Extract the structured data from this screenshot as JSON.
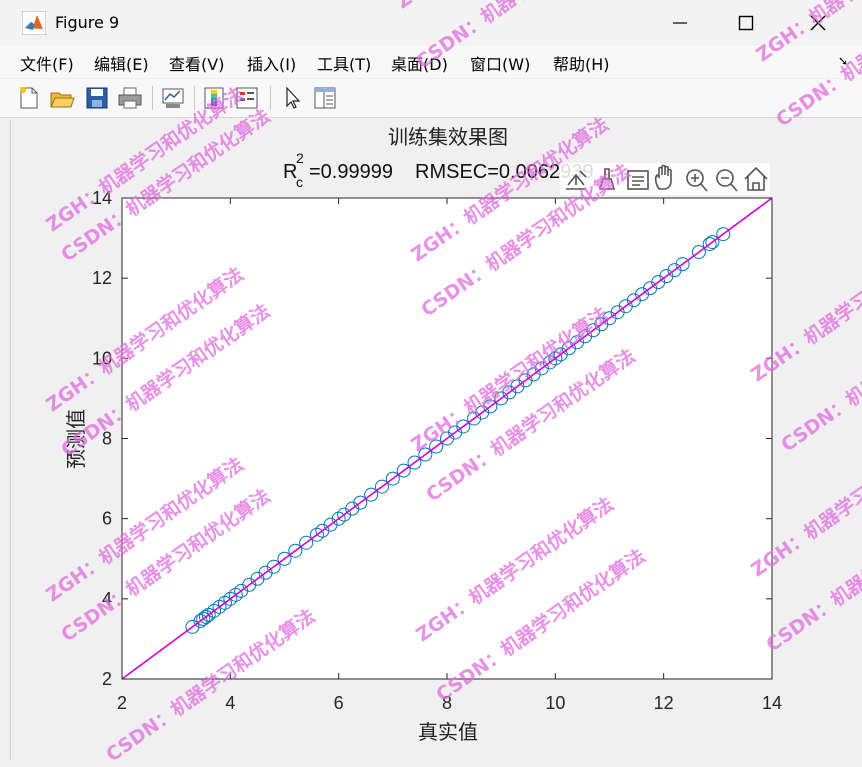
{
  "window": {
    "title": "Figure 9"
  },
  "menu": [
    "文件(F)",
    "编辑(E)",
    "查看(V)",
    "插入(I)",
    "工具(T)",
    "桌面(D)",
    "窗口(W)",
    "帮助(H)"
  ],
  "toolbar": {
    "buttons": [
      "new-figure-icon",
      "open-file-icon",
      "save-icon",
      "print-icon",
      "link-plot-icon",
      "insert-colorbar-icon",
      "insert-legend-icon",
      "edit-plot-arrow-icon",
      "property-inspector-icon"
    ]
  },
  "axes_toolbar": [
    "export-icon",
    "brush-icon",
    "data-tips-icon",
    "pan-icon",
    "zoom-in-icon",
    "zoom-out-icon",
    "home-icon"
  ],
  "watermarks": [
    "ZGH：机器学习和优化算法",
    "CSDN：机器学习和优化算法"
  ],
  "colors": {
    "marker": "#0072bd",
    "fit_line": "#d400d4",
    "watermark": "#e26be0"
  },
  "chart_data": {
    "type": "scatter",
    "title": "训练集效果图",
    "subtitle": {
      "r_label": "R",
      "r_sub": "c",
      "r_sup": "2",
      "r_value": "=0.99999",
      "rmse": "RMSEC=0.0062939"
    },
    "xlabel": "真实值",
    "ylabel": "预测值",
    "xlim": [
      2,
      14
    ],
    "ylim": [
      2,
      14
    ],
    "xticks": [
      2,
      4,
      6,
      8,
      10,
      12,
      14
    ],
    "yticks": [
      2,
      4,
      6,
      8,
      10,
      12,
      14
    ],
    "grid": false,
    "fit_line": {
      "x": [
        2,
        14
      ],
      "y": [
        2,
        14
      ]
    },
    "points": {
      "x": [
        3.3,
        3.45,
        3.5,
        3.55,
        3.6,
        3.7,
        3.8,
        3.9,
        4.0,
        4.1,
        4.2,
        4.35,
        4.5,
        4.65,
        4.8,
        5.0,
        5.2,
        5.4,
        5.6,
        5.7,
        5.85,
        6.0,
        6.1,
        6.25,
        6.4,
        6.6,
        6.8,
        7.0,
        7.2,
        7.4,
        7.6,
        7.8,
        8.0,
        8.15,
        8.3,
        8.5,
        8.65,
        8.8,
        9.0,
        9.15,
        9.3,
        9.45,
        9.6,
        9.75,
        9.9,
        10.0,
        10.1,
        10.25,
        10.4,
        10.55,
        10.7,
        10.85,
        11.0,
        11.15,
        11.3,
        11.45,
        11.6,
        11.75,
        11.9,
        12.05,
        12.2,
        12.35,
        12.65,
        12.85,
        12.9,
        13.1
      ],
      "y": [
        3.3,
        3.45,
        3.5,
        3.55,
        3.6,
        3.7,
        3.8,
        3.9,
        4.0,
        4.1,
        4.2,
        4.35,
        4.5,
        4.65,
        4.8,
        5.0,
        5.2,
        5.4,
        5.6,
        5.7,
        5.85,
        6.0,
        6.1,
        6.25,
        6.4,
        6.6,
        6.8,
        7.0,
        7.2,
        7.4,
        7.6,
        7.8,
        8.0,
        8.15,
        8.3,
        8.5,
        8.65,
        8.8,
        9.0,
        9.15,
        9.3,
        9.45,
        9.6,
        9.75,
        9.9,
        10.0,
        10.1,
        10.25,
        10.4,
        10.55,
        10.7,
        10.85,
        11.0,
        11.15,
        11.3,
        11.45,
        11.6,
        11.75,
        11.9,
        12.05,
        12.2,
        12.35,
        12.65,
        12.85,
        12.9,
        13.1
      ]
    }
  }
}
